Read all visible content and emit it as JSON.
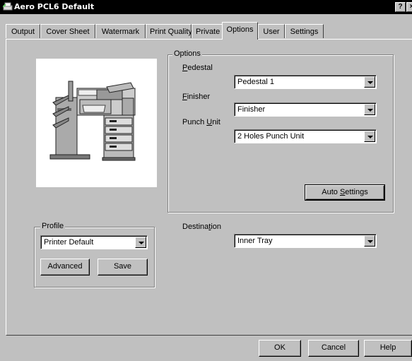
{
  "window": {
    "title": "Aero PCL6 Default",
    "help_btn": "?",
    "close_btn": "×"
  },
  "tabs": [
    {
      "label": "Output"
    },
    {
      "label": "Cover Sheet"
    },
    {
      "label": "Watermark"
    },
    {
      "label": "Print Quality"
    },
    {
      "label": "Private"
    },
    {
      "label": "Options",
      "active": true
    },
    {
      "label": "User"
    },
    {
      "label": "Settings"
    }
  ],
  "options_group": {
    "title": "Options",
    "pedestal_label_u": "P",
    "pedestal_label_rest": "edestal",
    "pedestal_value": "Pedestal 1",
    "finisher_label_u": "F",
    "finisher_label_rest": "inisher",
    "finisher_value": "Finisher",
    "punch_label_pre": "Punch ",
    "punch_label_u": "U",
    "punch_label_rest": "nit",
    "punch_value": "2 Holes Punch Unit",
    "auto_settings_pre": "Auto ",
    "auto_settings_u": "S",
    "auto_settings_rest": "ettings"
  },
  "destination": {
    "label_pre": "Destina",
    "label_u": "t",
    "label_rest": "ion",
    "value": "Inner Tray"
  },
  "profile": {
    "title": "Profile",
    "value": "Printer Default",
    "advanced_label": "Advanced",
    "save_label": "Save"
  },
  "footer": {
    "ok_label": "OK",
    "cancel_label": "Cancel",
    "help_label": "Help"
  },
  "colors": {
    "face": "#c0c0c0",
    "titlebar": "#000000"
  }
}
